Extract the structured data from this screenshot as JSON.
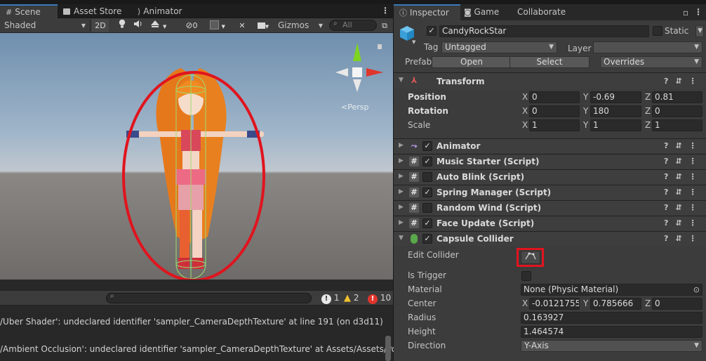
{
  "scene_panel": {
    "tabs": [
      {
        "icon": "grid-icon",
        "label": "Scene"
      },
      {
        "icon": "store-icon",
        "label": "Asset Store"
      },
      {
        "icon": "animator-icon",
        "label": "Animator"
      }
    ],
    "toolbar": {
      "shading_mode": "Shaded",
      "mode_2d": "2D",
      "hidden_count": "0",
      "gizmos": "Gizmos",
      "search_placeholder": "All"
    },
    "gizmo_label": "Persp"
  },
  "console": {
    "counts": {
      "info": "1",
      "warning": "2",
      "error": "10"
    },
    "lines": [
      "/Uber Shader': undeclared identifier 'sampler_CameraDepthTexture' at line 191 (on d3d11)",
      "/Ambient Occlusion': undeclared identifier 'sampler_CameraDepthTexture' at Assets/Assets/PostPr"
    ]
  },
  "inspector": {
    "tabs": [
      {
        "icon": "info-icon",
        "label": "Inspector"
      },
      {
        "icon": "gamepad-icon",
        "label": "Game"
      },
      {
        "icon": "",
        "label": "Collaborate"
      }
    ],
    "object": {
      "name": "CandyRockStar",
      "static_label": "Static",
      "tag_label": "Tag",
      "tag_value": "Untagged",
      "layer_label": "Layer",
      "layer_value": "",
      "prefab_label": "Prefab",
      "open_label": "Open",
      "select_label": "Select",
      "overrides_label": "Overrides"
    },
    "transform": {
      "title": "Transform",
      "position_label": "Position",
      "rotation_label": "Rotation",
      "scale_label": "Scale",
      "position": {
        "x": "0",
        "y": "-0.69",
        "z": "0.81"
      },
      "rotation": {
        "x": "0",
        "y": "180",
        "z": "0"
      },
      "scale": {
        "x": "1",
        "y": "1",
        "z": "1"
      }
    },
    "components": [
      {
        "name": "Animator",
        "icon": "animator-icon",
        "has_checkbox": true,
        "checked": true
      },
      {
        "name": "Music Starter (Script)",
        "icon": "script-icon",
        "checked": true
      },
      {
        "name": "Auto Blink (Script)",
        "icon": "script-icon",
        "checked": false
      },
      {
        "name": "Spring Manager (Script)",
        "icon": "script-icon",
        "checked": true
      },
      {
        "name": "Random Wind (Script)",
        "icon": "script-icon",
        "checked": false
      },
      {
        "name": "Face Update (Script)",
        "icon": "script-icon",
        "checked": true
      }
    ],
    "capsule_collider": {
      "title": "Capsule Collider",
      "edit_collider_label": "Edit Collider",
      "is_trigger_label": "Is Trigger",
      "material_label": "Material",
      "material_value": "None (Physic Material)",
      "center_label": "Center",
      "center": {
        "x": "-0.0121755",
        "y": "0.785666",
        "z": "0"
      },
      "radius_label": "Radius",
      "radius_value": "0.163927",
      "height_label": "Height",
      "height_value": "1.464574",
      "direction_label": "Direction",
      "direction_value": "Y-Axis"
    },
    "axis_labels": {
      "x": "X",
      "y": "Y",
      "z": "Z"
    }
  },
  "colors": {
    "accent_tab": "#3a79bb",
    "highlight": "#e0141e",
    "gizmo_x": "#e0352c",
    "gizmo_y": "#7ed321",
    "capsule": "#9fdc6c"
  }
}
